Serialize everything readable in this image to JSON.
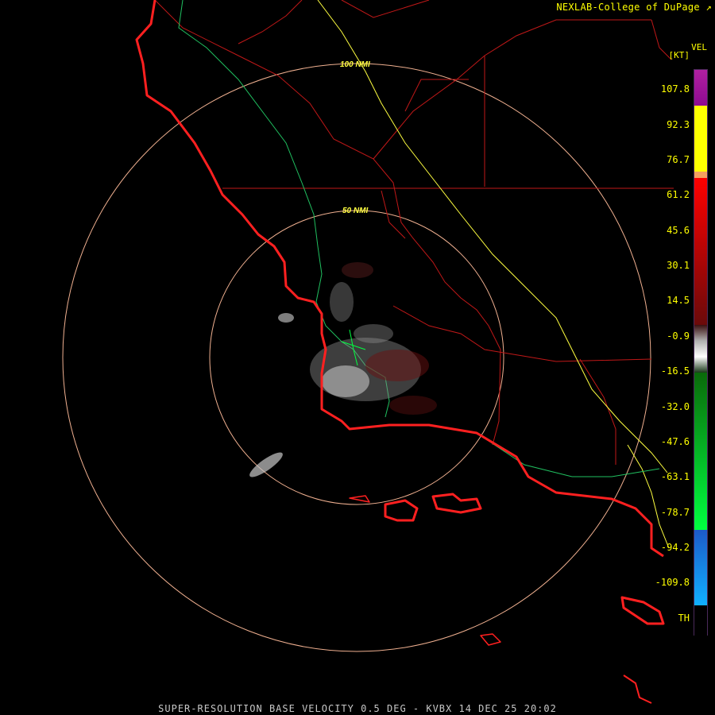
{
  "credit": "NEXLAB-College of DuPage",
  "credit_icon": "external-link-icon",
  "legend": {
    "title": "VEL",
    "unit": "[KT]",
    "ticks": [
      "107.8",
      "92.3",
      "76.7",
      "61.2",
      "45.6",
      "30.1",
      "14.5",
      "-0.9",
      "-16.5",
      "-32.0",
      "-47.6",
      "-63.1",
      "-78.7",
      "-94.2",
      "-109.8",
      "TH"
    ],
    "colors": {
      "purple": "#8e0a92",
      "yellow": "#ffff00",
      "orange": "#f5a060",
      "red": "#ff0000",
      "dark_red": "#6a0a0a",
      "gray": "#b0b0b0",
      "dark_green": "#0a6a0a",
      "green": "#00ff40",
      "blue": "#1c5ac8",
      "cyan": "#10b0ff",
      "black": "#000000"
    }
  },
  "range_rings": [
    {
      "label": "100 NMI"
    },
    {
      "label": "50 NMI"
    }
  ],
  "caption": "SUPER-RESOLUTION BASE VELOCITY 0.5 DEG - KVBX 14 DEC 25 20:02",
  "map_colors": {
    "coast": "#ff2020",
    "county": "#c01818",
    "highway": "#ffff40",
    "road": "#20c060",
    "ring": "#f0b090",
    "ring_label": "#ffff40"
  }
}
